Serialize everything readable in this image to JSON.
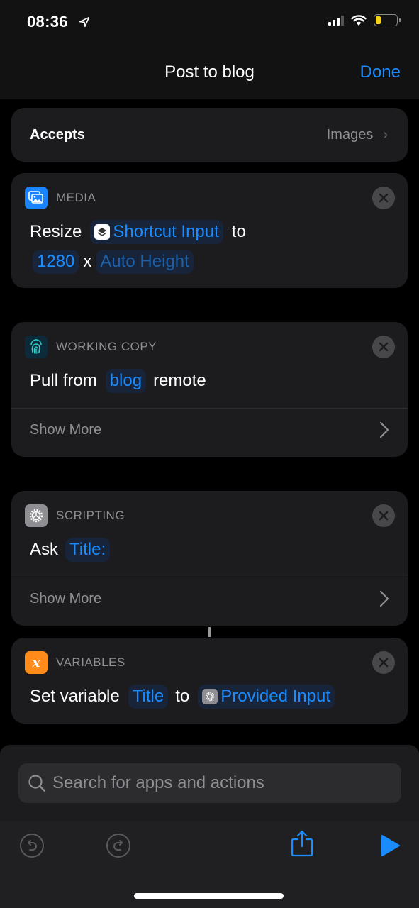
{
  "status_bar": {
    "time": "08:36",
    "battery_color": "#f6d219"
  },
  "nav": {
    "title": "Post to blog",
    "done_label": "Done"
  },
  "accepts": {
    "label": "Accepts",
    "value": "Images"
  },
  "actions": [
    {
      "category": "MEDIA",
      "icon": "media-icon",
      "icon_color": "#1a84ff",
      "verb": "Resize",
      "input_token": "Shortcut Input",
      "connector": "to",
      "width_token": "1280",
      "separator": "x",
      "height_token": "Auto Height"
    },
    {
      "category": "WORKING COPY",
      "icon": "fingerprint-icon",
      "icon_color": "#0d2a3a",
      "prefix": "Pull from",
      "token": "blog",
      "suffix": "remote",
      "show_more": "Show More"
    },
    {
      "category": "SCRIPTING",
      "icon": "gear-icon",
      "icon_color": "#8e8e93",
      "verb": "Ask",
      "token": "Title:",
      "show_more": "Show More"
    },
    {
      "category": "VARIABLES",
      "icon": "variable-icon",
      "icon_color": "#ff8c1a",
      "icon_glyph": "x",
      "verb": "Set variable",
      "var_token": "Title",
      "connector": "to",
      "value_token": "Provided Input"
    }
  ],
  "search": {
    "placeholder": "Search for apps and actions"
  },
  "accent_color": "#1a8cff"
}
